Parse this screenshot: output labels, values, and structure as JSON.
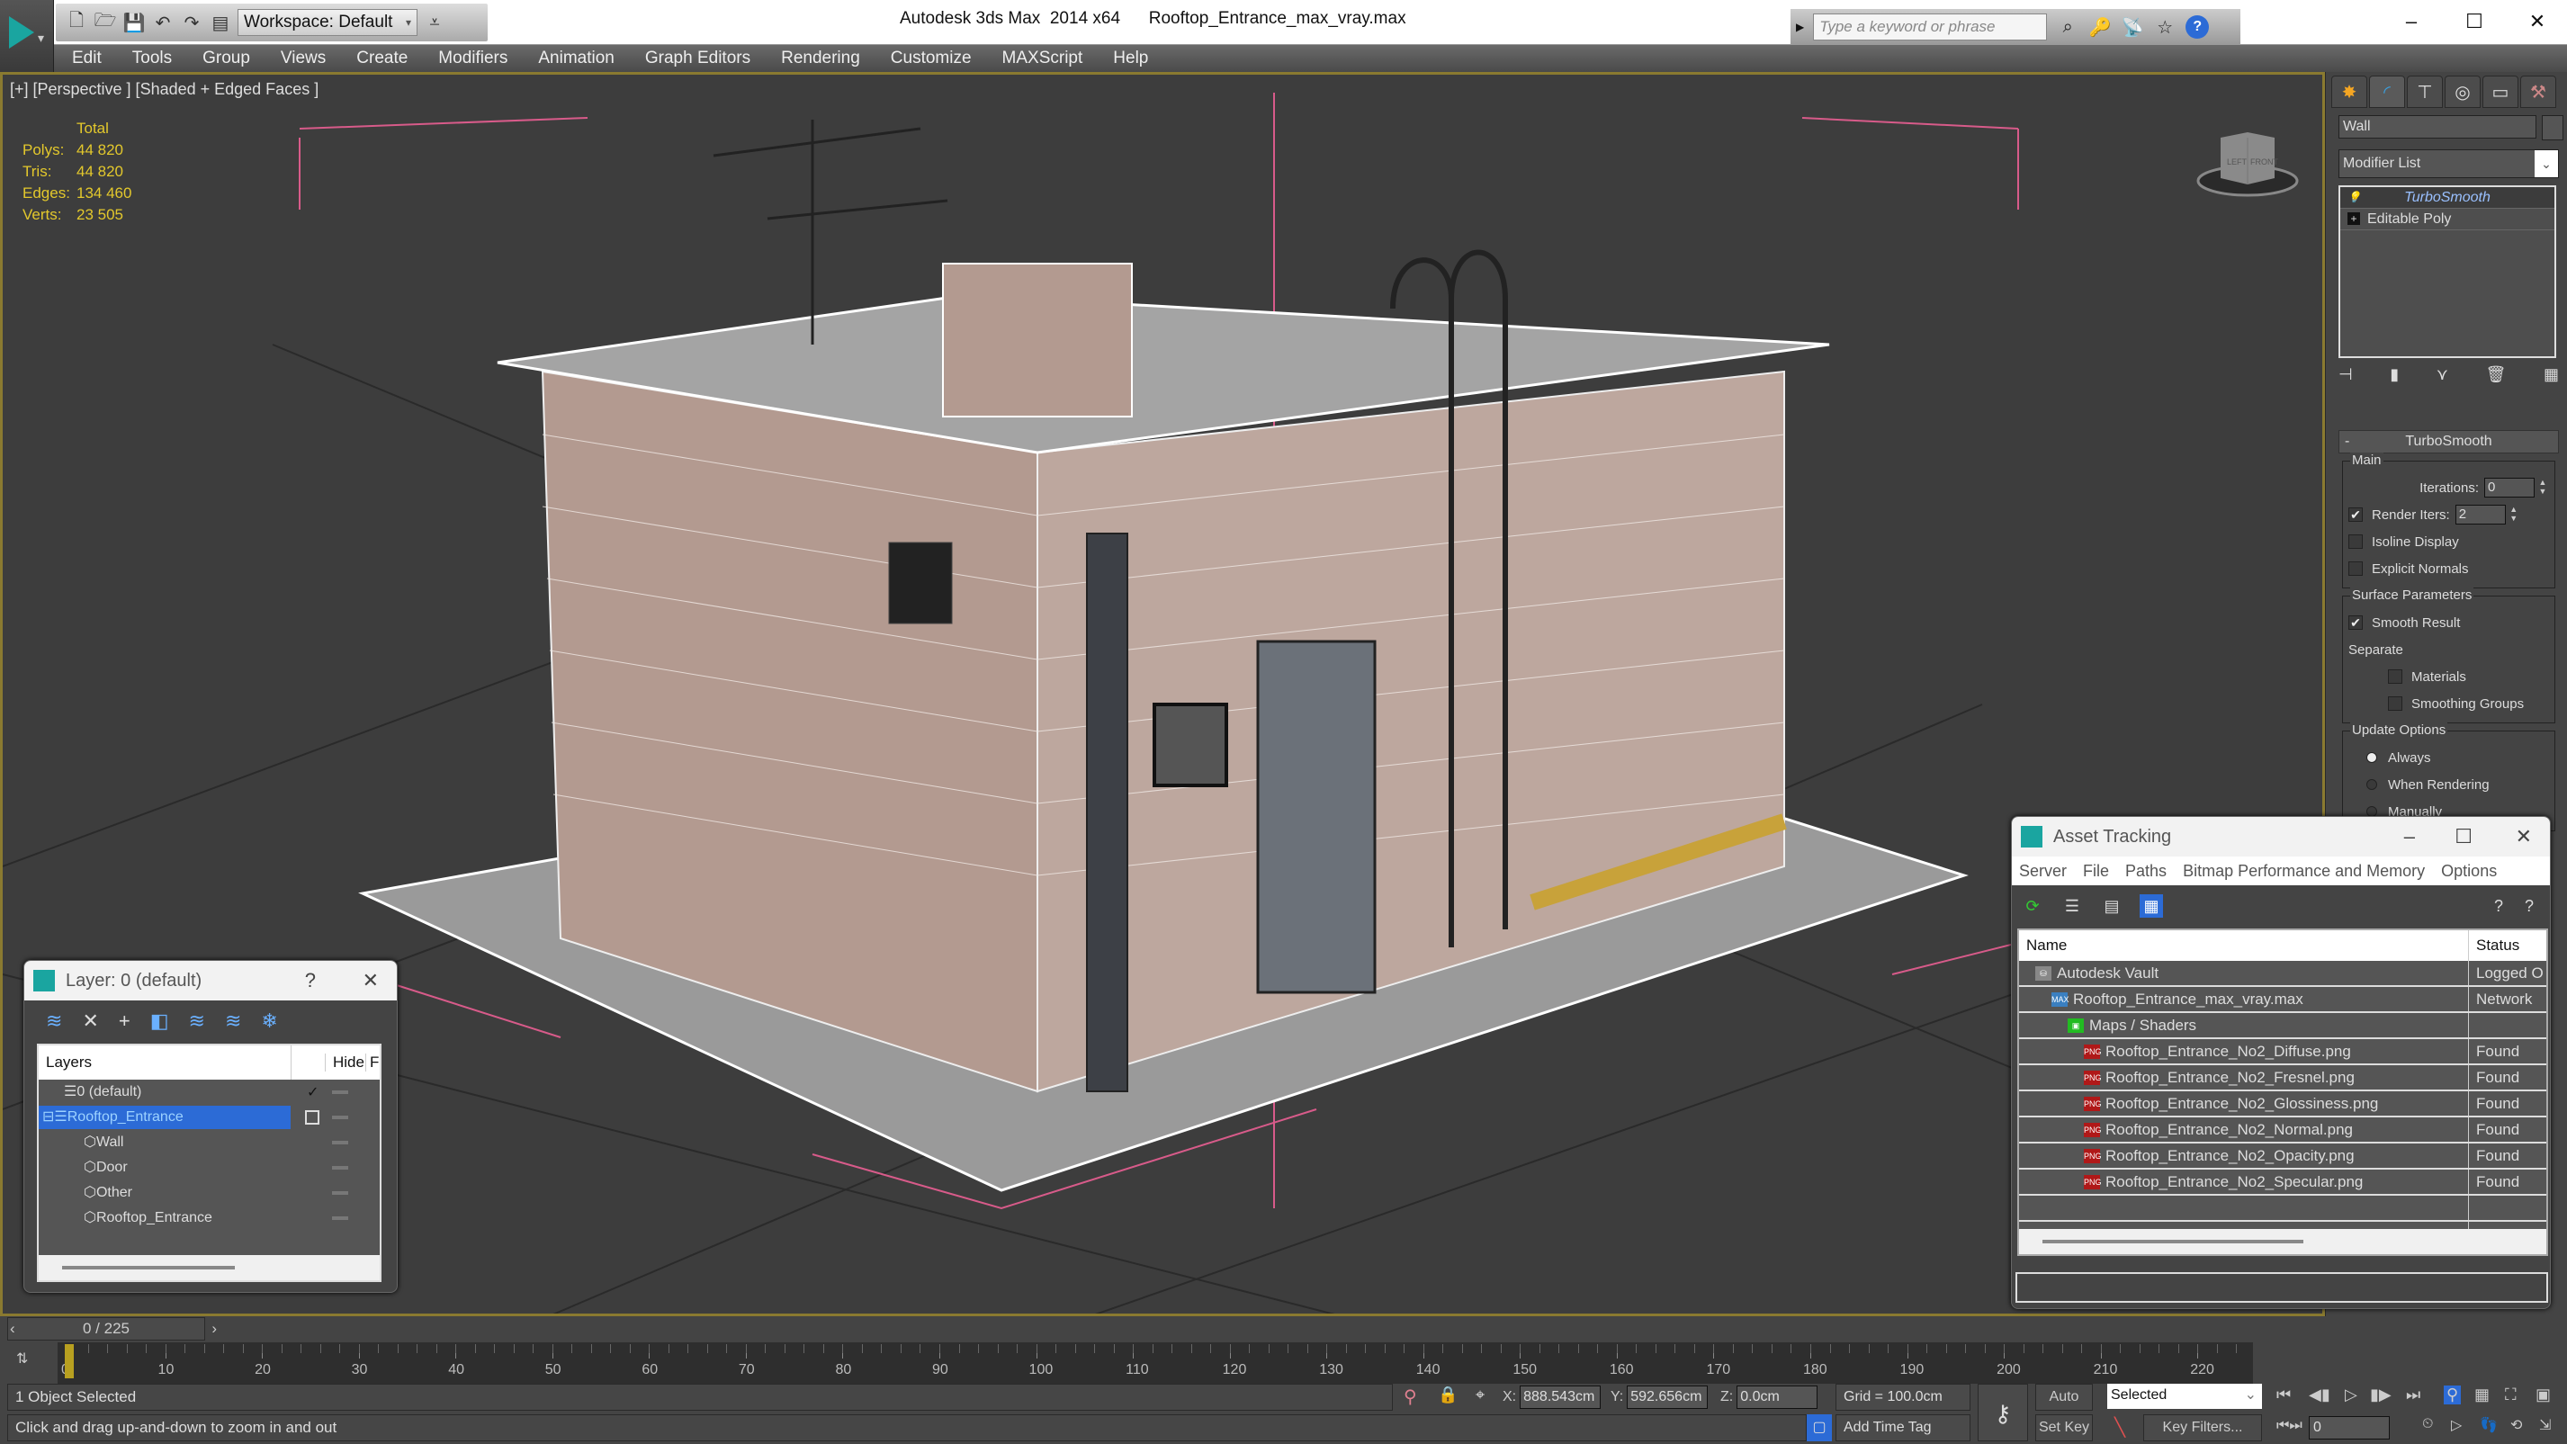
{
  "window": {
    "app_title": "Autodesk 3ds Max  2014 x64",
    "file_title": "Rooftop_Entrance_max_vray.max",
    "workspace": "Workspace: Default",
    "search_placeholder": "Type a keyword or phrase",
    "controls": {
      "minimize": "–",
      "maximize": "☐",
      "close": "✕"
    }
  },
  "menu": [
    "Edit",
    "Tools",
    "Group",
    "Views",
    "Create",
    "Modifiers",
    "Animation",
    "Graph Editors",
    "Rendering",
    "Customize",
    "MAXScript",
    "Help"
  ],
  "viewport": {
    "label": "[+] [Perspective ] [Shaded + Edged Faces ]",
    "stats": {
      "header": "Total",
      "rows": [
        {
          "k": "Polys:",
          "v": "44 820"
        },
        {
          "k": "Tris:",
          "v": "44 820"
        },
        {
          "k": "Edges:",
          "v": "134 460"
        },
        {
          "k": "Verts:",
          "v": "23 505"
        }
      ]
    },
    "viewcube": {
      "left": "LEFT",
      "front": "FRONT"
    }
  },
  "command_panel": {
    "object_name": "Wall",
    "modifier_list": "Modifier List",
    "stack": [
      "TurboSmooth",
      "Editable Poly"
    ],
    "rollout": {
      "title": "TurboSmooth",
      "main_group": "Main",
      "iterations_label": "Iterations:",
      "iterations_value": "0",
      "render_iters_label": "Render Iters:",
      "render_iters_value": "2",
      "render_iters_checked": true,
      "isoline_display": "Isoline Display",
      "explicit_normals": "Explicit Normals",
      "surface_group": "Surface Parameters",
      "smooth_result": "Smooth Result",
      "separate": "Separate",
      "materials": "Materials",
      "smoothing_groups": "Smoothing Groups",
      "update_group": "Update Options",
      "update_options": [
        "Always",
        "When Rendering",
        "Manually"
      ],
      "update_selected": "Always"
    }
  },
  "layer_window": {
    "title": "Layer: 0 (default)",
    "help": "?",
    "close": "✕",
    "columns": [
      "Layers",
      "",
      "Hide",
      "F"
    ],
    "rows": [
      {
        "name": "0 (default)",
        "type": "layer",
        "current": true
      },
      {
        "name": "Rooftop_Entrance",
        "type": "layer",
        "selected": true
      },
      {
        "name": "Wall",
        "type": "object"
      },
      {
        "name": "Door",
        "type": "object"
      },
      {
        "name": "Other",
        "type": "object"
      },
      {
        "name": "Rooftop_Entrance",
        "type": "object"
      }
    ]
  },
  "asset_tracking": {
    "title": "Asset Tracking",
    "menu": [
      "Server",
      "File",
      "Paths",
      "Bitmap Performance and Memory",
      "Options"
    ],
    "columns": [
      "Name",
      "Status"
    ],
    "rows": [
      {
        "name": "Autodesk Vault",
        "status": "Logged O",
        "indent": 1,
        "icon": "vault"
      },
      {
        "name": "Rooftop_Entrance_max_vray.max",
        "status": "Network",
        "indent": 2,
        "icon": "max"
      },
      {
        "name": "Maps / Shaders",
        "status": "",
        "indent": 3,
        "icon": "maps"
      },
      {
        "name": "Rooftop_Entrance_No2_Diffuse.png",
        "status": "Found",
        "indent": 4,
        "icon": "png"
      },
      {
        "name": "Rooftop_Entrance_No2_Fresnel.png",
        "status": "Found",
        "indent": 4,
        "icon": "png"
      },
      {
        "name": "Rooftop_Entrance_No2_Glossiness.png",
        "status": "Found",
        "indent": 4,
        "icon": "png"
      },
      {
        "name": "Rooftop_Entrance_No2_Normal.png",
        "status": "Found",
        "indent": 4,
        "icon": "png"
      },
      {
        "name": "Rooftop_Entrance_No2_Opacity.png",
        "status": "Found",
        "indent": 4,
        "icon": "png"
      },
      {
        "name": "Rooftop_Entrance_No2_Specular.png",
        "status": "Found",
        "indent": 4,
        "icon": "png"
      }
    ]
  },
  "timeline": {
    "slider": "0 / 225",
    "current_frame": 0,
    "total_frames": 225,
    "ticks": [
      "0",
      "10",
      "20",
      "30",
      "40",
      "50",
      "60",
      "70",
      "80",
      "90",
      "100",
      "110",
      "120",
      "130",
      "140",
      "150",
      "160",
      "170",
      "180",
      "190",
      "200",
      "210",
      "220"
    ]
  },
  "status": {
    "selection": "1 Object Selected",
    "prompt": "Click and drag up-and-down to zoom in and out",
    "x": "888.543cm",
    "y": "592.656cm",
    "z": "0.0cm",
    "grid": "Grid = 100.0cm",
    "add_time_tag": "Add Time Tag",
    "auto_key": "Auto Key",
    "set_key": "Set Key",
    "key_mode": "Selected",
    "key_filters": "Key Filters...",
    "frame": "0"
  }
}
